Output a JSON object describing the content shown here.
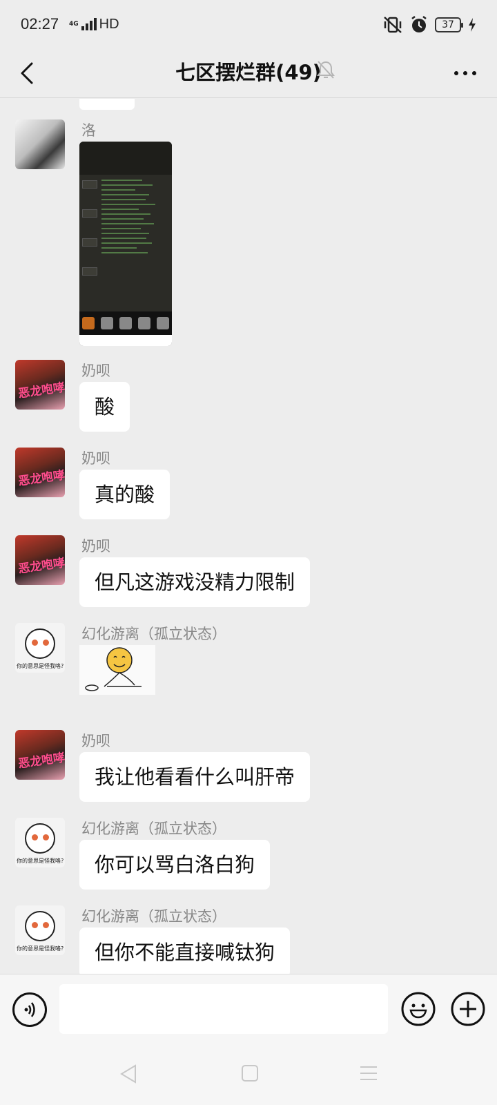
{
  "status_bar": {
    "time": "02:27",
    "network_small": "4G",
    "network": "HD",
    "battery": "37"
  },
  "header": {
    "title": "七区摆烂群(49)"
  },
  "messages": [
    {
      "sender": "洛",
      "kind": "image"
    },
    {
      "sender": "奶呗",
      "kind": "text",
      "text": "酸"
    },
    {
      "sender": "奶呗",
      "kind": "text",
      "text": "真的酸"
    },
    {
      "sender": "奶呗",
      "kind": "text",
      "text": "但凡这游戏没精力限制"
    },
    {
      "sender": "幻化游离（孤立状态）",
      "kind": "sticker"
    },
    {
      "sender": "奶呗",
      "kind": "text",
      "text": "我让他看看什么叫肝帝"
    },
    {
      "sender": "幻化游离（孤立状态）",
      "kind": "text",
      "text": "你可以骂白洛白狗"
    },
    {
      "sender": "幻化游离（孤立状态）",
      "kind": "text",
      "text": "但你不能直接喊钛狗"
    }
  ],
  "avatars": {
    "naibei_text": "恶龙咆哮",
    "huanhua_caption": "你的意思是怪我咯?"
  },
  "colors": {
    "background": "#ededed",
    "bubble": "#ffffff",
    "sender_name": "#888888"
  }
}
